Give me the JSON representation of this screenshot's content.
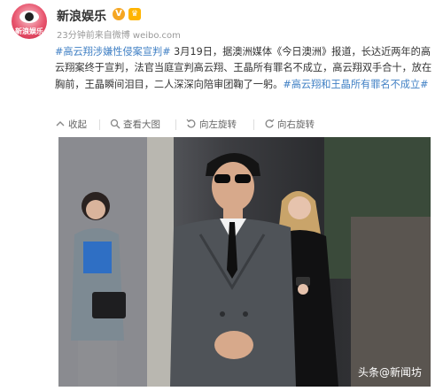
{
  "account": {
    "name": "新浪娱乐",
    "meta": "23分钟前来自微博 weibo.com",
    "avatar_text": "新浪娱乐",
    "verified_icon": "verified-icon",
    "badge_icon": "vip-badge-icon"
  },
  "post": {
    "topic1": "#高云翔涉嫌性侵案宣判#",
    "body": " 3月19日，据澳洲媒体《今日澳洲》报道，长达近两年的高云翔案终于宣判，法官当庭宣判高云翔、王晶所有罪名不成立，高云翔双手合十，放在胸前，王晶瞬间泪目，二人深深向陪审团鞠了一躬。",
    "topic2": "#高云翔和王晶所有罪名不成立#"
  },
  "toolbar": {
    "collapse": "收起",
    "view_large": "查看大图",
    "rotate_left": "向左旋转",
    "rotate_right": "向右旋转"
  },
  "photo": {
    "watermark": "头条@新闻坊"
  },
  "colors": {
    "topic": "#3f7fc4",
    "text": "#333333",
    "meta": "#999999"
  }
}
